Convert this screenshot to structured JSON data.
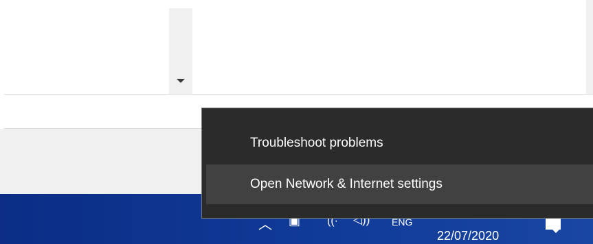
{
  "context_menu": {
    "items": [
      {
        "label": "Troubleshoot problems"
      },
      {
        "label": "Open Network & Internet settings"
      }
    ]
  },
  "taskbar": {
    "language": "ENG",
    "date": "22/07/2020",
    "icons": [
      "chevron-up-icon",
      "battery-icon",
      "wifi-icon",
      "volume-icon",
      "notification-icon"
    ],
    "accent": "#0b2d86"
  }
}
